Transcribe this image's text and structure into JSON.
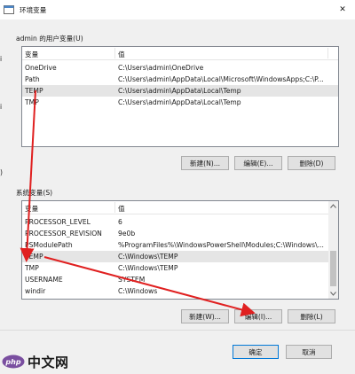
{
  "window": {
    "title": "环境变量",
    "close_glyph": "✕"
  },
  "user_vars": {
    "group_label": "admin 的用户变量(U)",
    "headers": [
      "变量",
      "值"
    ],
    "rows": [
      {
        "name": "OneDrive",
        "value": "C:\\Users\\admin\\OneDrive"
      },
      {
        "name": "Path",
        "value": "C:\\Users\\admin\\AppData\\Local\\Microsoft\\WindowsApps;C:\\P..."
      },
      {
        "name": "TEMP",
        "value": "C:\\Users\\admin\\AppData\\Local\\Temp",
        "selected": true
      },
      {
        "name": "TMP",
        "value": "C:\\Users\\admin\\AppData\\Local\\Temp"
      }
    ],
    "buttons": {
      "new": "新建(N)...",
      "edit": "编辑(E)...",
      "delete": "删除(D)"
    }
  },
  "system_vars": {
    "group_label": "系统变量(S)",
    "headers": [
      "变量",
      "值"
    ],
    "rows": [
      {
        "name": "PROCESSOR_LEVEL",
        "value": "6"
      },
      {
        "name": "PROCESSOR_REVISION",
        "value": "9e0b"
      },
      {
        "name": "PSModulePath",
        "value": "%ProgramFiles%\\WindowsPowerShell\\Modules;C:\\Windows\\..."
      },
      {
        "name": "TEMP",
        "value": "C:\\Windows\\TEMP",
        "selected": true
      },
      {
        "name": "TMP",
        "value": "C:\\Windows\\TEMP"
      },
      {
        "name": "USERNAME",
        "value": "SYSTEM"
      },
      {
        "name": "windir",
        "value": "C:\\Windows"
      }
    ],
    "buttons": {
      "new": "新建(W)...",
      "edit": "编辑(I)...",
      "delete": "删除(L)"
    }
  },
  "footer": {
    "ok": "确定",
    "cancel": "取消"
  },
  "watermark": {
    "text": "中文网",
    "logo_text": "php"
  },
  "colors": {
    "accent": "#0078d7",
    "arrow": "#e02020",
    "selection": "#e5e5e5",
    "dialog_bg": "#f0f0f0",
    "logo": "#7a4fa0"
  },
  "icons": [
    "window-icon",
    "close-icon",
    "scroll-up-icon",
    "scroll-down-icon",
    "annotation-arrow-icon",
    "php-logo-icon"
  ]
}
